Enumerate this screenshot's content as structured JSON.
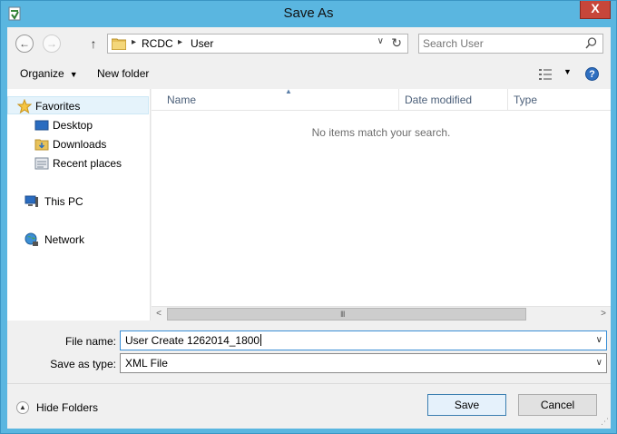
{
  "window": {
    "title": "Save As",
    "close_glyph": "X"
  },
  "nav": {
    "back_glyph": "←",
    "forward_glyph": "→",
    "up_glyph": "↑"
  },
  "address": {
    "sep": "▸",
    "crumbs": [
      "RCDC",
      "User"
    ],
    "dropdown_glyph": "∨",
    "refresh_glyph": "↻"
  },
  "search": {
    "placeholder": "Search User"
  },
  "toolbar": {
    "organize_label": "Organize",
    "new_folder_label": "New folder",
    "caret": "▼",
    "help_glyph": "?"
  },
  "sidebar": {
    "items": [
      {
        "label": "Favorites",
        "icon": "star-icon"
      },
      {
        "label": "Desktop",
        "icon": "desktop-icon"
      },
      {
        "label": "Downloads",
        "icon": "downloads-folder-icon"
      },
      {
        "label": "Recent places",
        "icon": "recent-places-icon"
      },
      {
        "label": "This PC",
        "icon": "computer-icon"
      },
      {
        "label": "Network",
        "icon": "network-icon"
      }
    ]
  },
  "file_list": {
    "columns": [
      "Name",
      "Date modified",
      "Type"
    ],
    "sort_glyph": "▲",
    "empty_message": "No items match your search."
  },
  "scrollbar": {
    "left_glyph": "<",
    "right_glyph": ">",
    "grip": "III"
  },
  "form": {
    "file_name_label": "File name:",
    "file_name_value": "User Create 1262014_1800",
    "save_type_label": "Save as type:",
    "save_type_value": "XML File",
    "dropdown_glyph": "∨"
  },
  "footer": {
    "hide_folders_label": "Hide Folders",
    "hide_folders_glyph": "▲",
    "save_label": "Save",
    "cancel_label": "Cancel"
  },
  "colors": {
    "titlebar": "#5ab6e0",
    "close_button": "#c7463a",
    "selection": "#e5f3fb",
    "header_text": "#4c607a"
  }
}
